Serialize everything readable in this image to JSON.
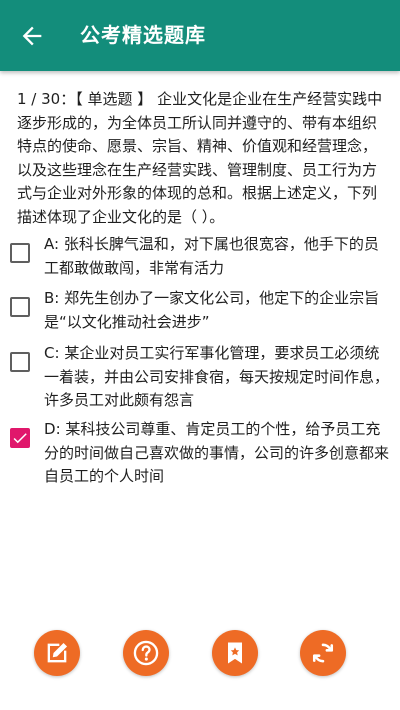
{
  "appbar": {
    "title": "公考精选题库",
    "back_icon": "arrow-left-icon"
  },
  "question": {
    "number": "1 / 30",
    "type_label": "【 单选题 】",
    "stem": "企业文化是企业在生产经营实践中逐步形成的，为全体员工所认同并遵守的、带有本组织特点的使命、愿景、宗旨、精神、价值观和经营理念，以及这些理念在生产经营实践、管理制度、员工行为方式与企业对外形象的体现的总和。根据上述定义，下列描述体现了企业文化的是（ ）。"
  },
  "options": [
    {
      "key": "A",
      "text": "张科长脾气温和，对下属也很宽容，他手下的员工都敢做敢闯，非常有活力",
      "checked": false
    },
    {
      "key": "B",
      "text": "郑先生创办了一家文化公司，他定下的企业宗旨是“以文化推动社会进步”",
      "checked": false
    },
    {
      "key": "C",
      "text": "某企业对员工实行军事化管理，要求员工必须统一着装，并由公司安排食宿，每天按规定时间作息，许多员工对此颇有怨言",
      "checked": false
    },
    {
      "key": "D",
      "text": "某科技公司尊重、肯定员工的个性，给予员工充分的时间做自己喜欢做的事情，公司的许多创意都来自员工的个人时间",
      "checked": true
    }
  ],
  "toolbar": [
    {
      "name": "note-button",
      "icon": "edit-icon"
    },
    {
      "name": "hint-button",
      "icon": "question-icon"
    },
    {
      "name": "bookmark-button",
      "icon": "bookmark-star-icon"
    },
    {
      "name": "refresh-button",
      "icon": "refresh-icon"
    }
  ],
  "colors": {
    "appbar": "#138d7b",
    "checked": "#e0176b",
    "fab": "#ee6b25"
  }
}
